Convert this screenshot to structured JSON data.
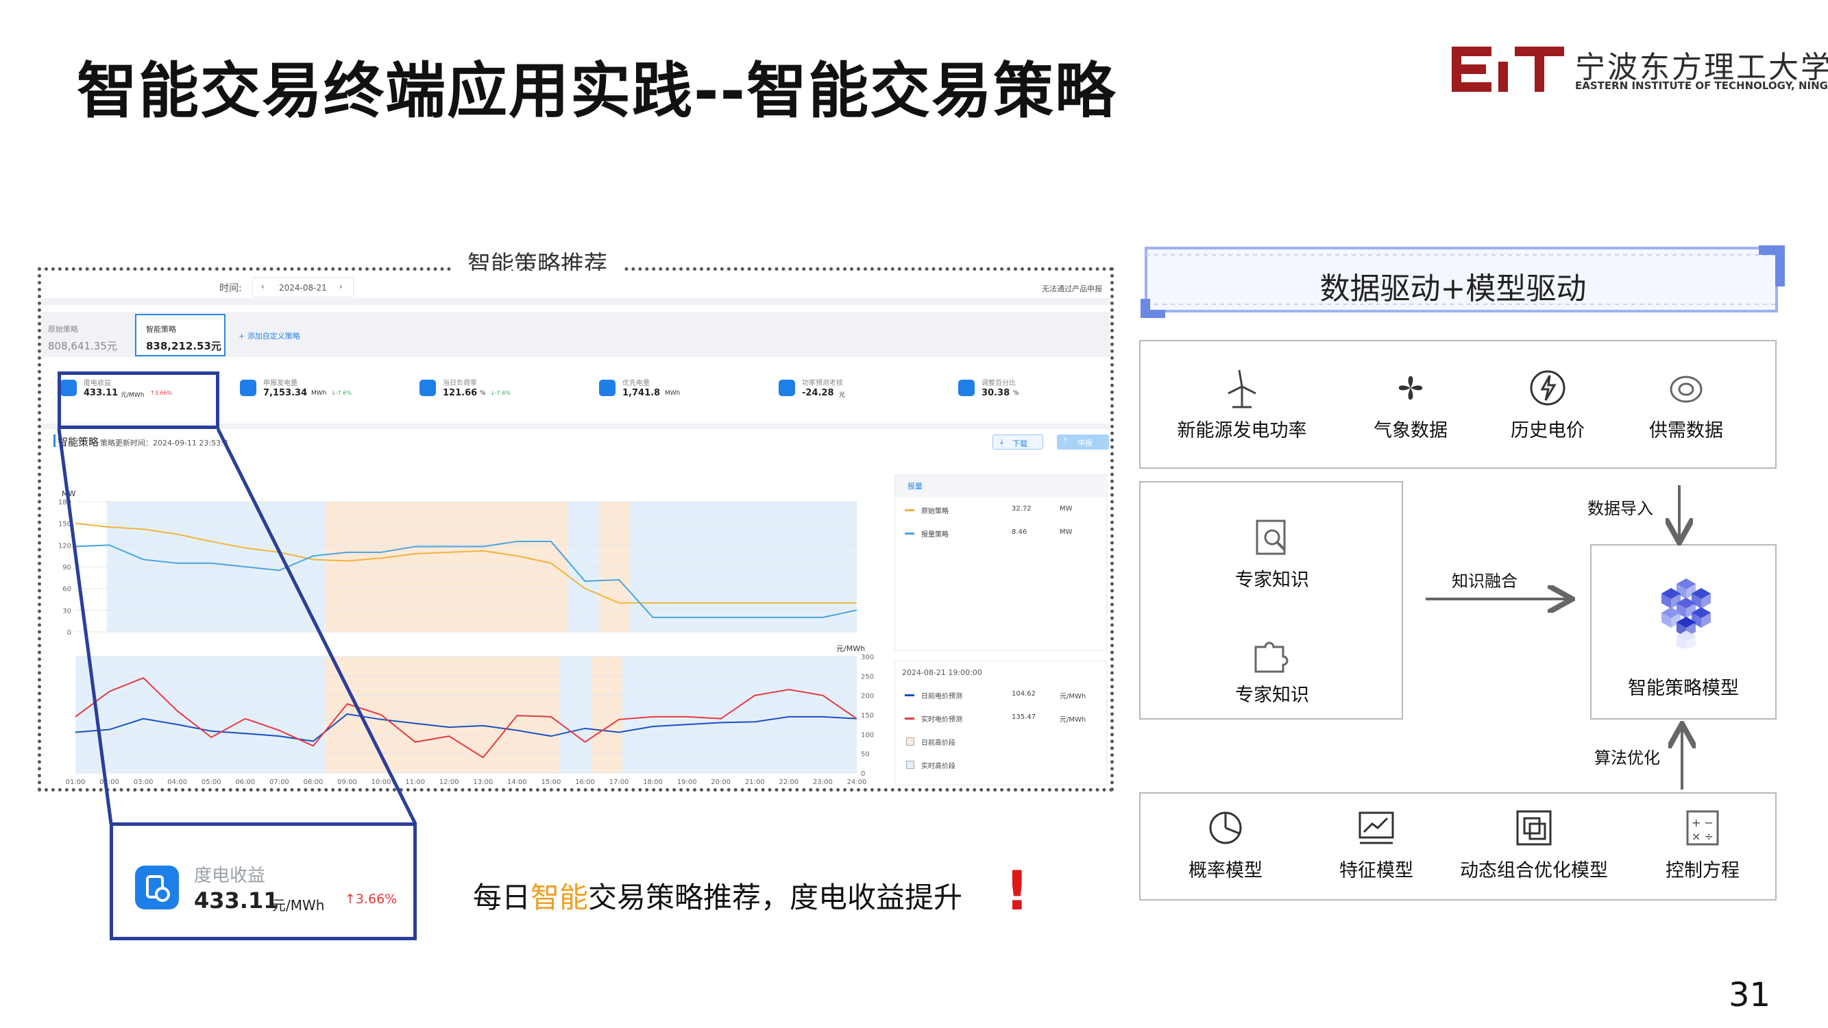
{
  "slide": {
    "title": "智能交易终端应用实践--智能交易策略",
    "school_cn": "宁波东方理工大学",
    "school_en": "EASTERN INSTITUTE OF TECHNOLOGY, NINGBO",
    "logo_text": "EIT",
    "page": "31"
  },
  "screenshot": {
    "caption": "智能策略推荐",
    "time_label": "时间:",
    "date": "2024-08-21",
    "notice": "无法通过产品申报",
    "tabs": [
      {
        "label": "原始策略",
        "value": "808,641.35元"
      },
      {
        "label": "智能策略",
        "value": "838,212.53元"
      }
    ],
    "add_strategy": "+ 添加自定义策略",
    "metrics": [
      {
        "label": "度电收益",
        "value": "433.11",
        "unit": "元/MWh",
        "delta": "↑3.66%"
      },
      {
        "label": "申报发电量",
        "value": "7,153.34",
        "unit": "MWh",
        "delta": "↓-7.6%"
      },
      {
        "label": "当日负荷率",
        "value": "121.66",
        "unit": "%",
        "delta": "↓-7.6%"
      },
      {
        "label": "优先电量",
        "value": "1,741.8",
        "unit": "MWh",
        "delta": ""
      },
      {
        "label": "功率预测考核",
        "value": "-24.28",
        "unit": "元",
        "delta": ""
      },
      {
        "label": "调整百分比",
        "value": "30.38",
        "unit": "%",
        "delta": ""
      }
    ],
    "section_title": "智能策略",
    "update_time": "策略更新时间：2024-09-11 23:53:3",
    "download": "下载",
    "declare": "申报",
    "chart1_unit": "MW",
    "chart2_unit": "元/MWh",
    "legend_tab": "报量",
    "legend1": [
      {
        "name": "原始策略",
        "value": "32.72",
        "unit": "MW"
      },
      {
        "name": "报量策略",
        "value": "8.46",
        "unit": "MW"
      }
    ],
    "legend2_time": "2024-08-21 19:00:00",
    "legend2": [
      {
        "name": "日前电价预测",
        "value": "104.62",
        "unit": "元/MWh"
      },
      {
        "name": "实时电价预测",
        "value": "135.47",
        "unit": "元/MWh"
      },
      {
        "name": "日前高价段",
        "value": "",
        "unit": ""
      },
      {
        "name": "实时高价段",
        "value": "",
        "unit": ""
      }
    ]
  },
  "chart_data": [
    {
      "type": "line",
      "x": [
        "01:00",
        "02:00",
        "03:00",
        "04:00",
        "05:00",
        "06:00",
        "07:00",
        "08:00",
        "09:00",
        "10:00",
        "11:00",
        "12:00",
        "13:00",
        "14:00",
        "15:00",
        "16:00",
        "17:00",
        "18:00",
        "19:00",
        "20:00",
        "21:00",
        "22:00",
        "23:00",
        "24:00"
      ],
      "ylabel": "MW",
      "yticks": [
        0,
        30,
        60,
        90,
        120,
        150,
        180
      ],
      "ylim": [
        0,
        180
      ],
      "series": [
        {
          "name": "原始策略",
          "color": "#f2b33d",
          "values": [
            150,
            145,
            142,
            135,
            125,
            116,
            110,
            100,
            98,
            102,
            108,
            110,
            112,
            105,
            95,
            60,
            40,
            40,
            40,
            40,
            40,
            40,
            40,
            40
          ]
        },
        {
          "name": "报量策略",
          "color": "#4aa3df",
          "values": [
            118,
            120,
            100,
            95,
            95,
            90,
            85,
            105,
            110,
            110,
            118,
            118,
            118,
            125,
            125,
            70,
            72,
            20,
            20,
            20,
            20,
            20,
            20,
            30
          ]
        }
      ]
    },
    {
      "type": "line",
      "x": [
        "01:00",
        "02:00",
        "03:00",
        "04:00",
        "05:00",
        "06:00",
        "07:00",
        "08:00",
        "09:00",
        "10:00",
        "11:00",
        "12:00",
        "13:00",
        "14:00",
        "15:00",
        "16:00",
        "17:00",
        "18:00",
        "19:00",
        "20:00",
        "21:00",
        "22:00",
        "23:00",
        "24:00"
      ],
      "ylabel": "元/MWh",
      "yticks": [
        0,
        50,
        100,
        150,
        200,
        250,
        300
      ],
      "ylim": [
        0,
        300
      ],
      "series": [
        {
          "name": "日前电价预测",
          "color": "#1a4fc4",
          "values": [
            105,
            112,
            140,
            125,
            108,
            102,
            95,
            82,
            152,
            138,
            128,
            118,
            122,
            110,
            95,
            115,
            105,
            120,
            125,
            130,
            132,
            145,
            145,
            140
          ]
        },
        {
          "name": "实时电价预测",
          "color": "#e8383d",
          "values": [
            145,
            210,
            245,
            160,
            92,
            140,
            110,
            70,
            178,
            150,
            80,
            95,
            40,
            148,
            145,
            80,
            138,
            145,
            145,
            140,
            200,
            215,
            200,
            140
          ]
        }
      ]
    }
  ],
  "right": {
    "header": "数据驱动+模型驱动",
    "data_items": [
      {
        "label": "新能源发电功率",
        "icon": "wind-turbine-icon"
      },
      {
        "label": "气象数据",
        "icon": "fan-icon"
      },
      {
        "label": "历史电价",
        "icon": "lightning-icon"
      },
      {
        "label": "供需数据",
        "icon": "rings-icon"
      }
    ],
    "knowledge": [
      {
        "label": "专家知识",
        "icon": "document-search-icon"
      },
      {
        "label": "专家知识",
        "icon": "puzzle-icon"
      }
    ],
    "knowledge_merge": "知识融合",
    "data_import": "数据导入",
    "algo_opt": "算法优化",
    "model": "智能策略模型",
    "models": [
      {
        "label": "概率模型",
        "icon": "pie-chart-icon"
      },
      {
        "label": "特征模型",
        "icon": "board-chart-icon"
      },
      {
        "label": "动态组合优化模型",
        "icon": "nested-squares-icon"
      },
      {
        "label": "控制方程",
        "icon": "calculator-icon"
      }
    ]
  },
  "bottom": {
    "pre": "每日",
    "hl": "智能",
    "post": "交易策略推荐，度电收益提升",
    "excl": "!"
  },
  "zoom": {
    "label": "度电收益",
    "value": "433.11",
    "unit": "元/MWh",
    "delta": "↑3.66%"
  }
}
